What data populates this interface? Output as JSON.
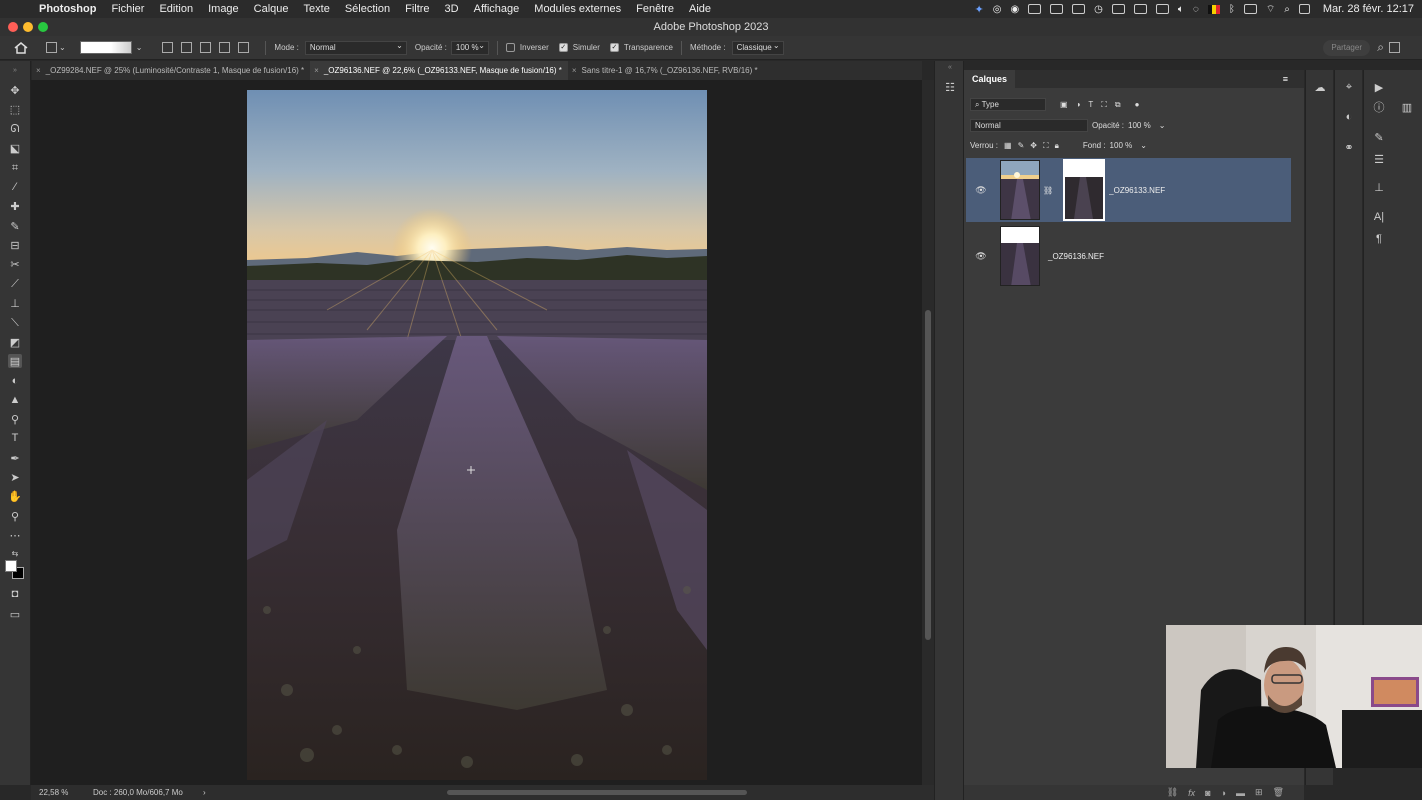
{
  "menubar": {
    "app_name": "Photoshop",
    "items": [
      "Fichier",
      "Edition",
      "Image",
      "Calque",
      "Texte",
      "Sélection",
      "Filtre",
      "3D",
      "Affichage",
      "Modules externes",
      "Fenêtre",
      "Aide"
    ],
    "clock": "Mar. 28 févr.  12:17"
  },
  "window": {
    "title": "Adobe Photoshop 2023"
  },
  "options": {
    "mode_label": "Mode :",
    "mode_value": "Normal",
    "opacity_label": "Opacité :",
    "opacity_value": "100 %",
    "inverser": "Inverser",
    "simuler": "Simuler",
    "transparence": "Transparence",
    "methode_label": "Méthode :",
    "methode_value": "Classique",
    "share": "Partager"
  },
  "tabs": [
    {
      "label": "_OZ99284.NEF @ 25% (Luminosité/Contraste 1, Masque de fusion/16) *"
    },
    {
      "label": "_OZ96136.NEF @ 22,6% (_OZ96133.NEF, Masque de fusion/16) *"
    },
    {
      "label": "Sans titre-1 @ 16,7% (_OZ96136.NEF, RVB/16) *"
    }
  ],
  "status": {
    "zoom": "22,58 %",
    "doc": "Doc : 260,0 Mo/606,7 Mo",
    "arrow": "›"
  },
  "layers_panel": {
    "title": "Calques",
    "filter_kind": "Type",
    "blend_mode": "Normal",
    "opacity_label": "Opacité :",
    "opacity_value": "100 %",
    "lock_label": "Verrou :",
    "fill_label": "Fond :",
    "fill_value": "100 %",
    "layers": [
      {
        "name": "_OZ96133.NEF",
        "selected": true,
        "has_mask": true
      },
      {
        "name": "_OZ96136.NEF",
        "selected": false,
        "has_mask": false
      }
    ]
  },
  "colors": {
    "accent_selection": "#4b5d79",
    "apple_red": "#ff5f57",
    "apple_yellow": "#febc2e",
    "apple_green": "#28c840"
  }
}
